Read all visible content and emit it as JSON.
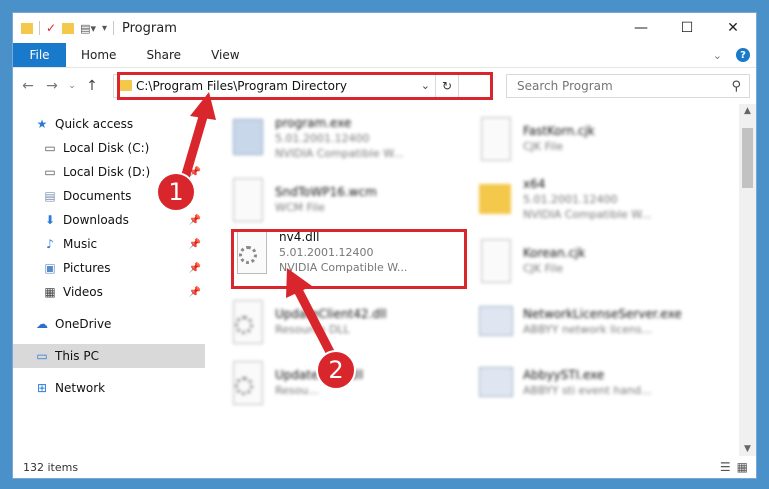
{
  "window": {
    "title": "Program"
  },
  "ribbon": {
    "file": "File",
    "home": "Home",
    "share": "Share",
    "view": "View"
  },
  "nav": {
    "address": "C:\\Program Files\\Program Directory",
    "search_placeholder": "Search Program"
  },
  "sidebar": {
    "items": [
      {
        "label": "Quick access",
        "icon": "star-icon"
      },
      {
        "label": "Local Disk (C:)",
        "icon": "drive-icon"
      },
      {
        "label": "Local Disk (D:)",
        "icon": "drive-icon"
      },
      {
        "label": "Documents",
        "icon": "documents-icon"
      },
      {
        "label": "Downloads",
        "icon": "download-icon"
      },
      {
        "label": "Music",
        "icon": "music-icon"
      },
      {
        "label": "Pictures",
        "icon": "pictures-icon"
      },
      {
        "label": "Videos",
        "icon": "videos-icon"
      },
      {
        "label": "OneDrive",
        "icon": "cloud-icon"
      },
      {
        "label": "This PC",
        "icon": "computer-icon"
      },
      {
        "label": "Network",
        "icon": "network-icon"
      }
    ]
  },
  "files": [
    {
      "name": "program.exe",
      "line2": "5.01.2001.12400",
      "line3": "NVIDIA Compatible W...",
      "icon": "exe"
    },
    {
      "name": "FastKorn.cjk",
      "line2": "CJK File",
      "line3": "",
      "icon": "page"
    },
    {
      "name": "SndToWP16.wcm",
      "line2": "WCM File",
      "line3": "",
      "icon": "page"
    },
    {
      "name": "x64",
      "line2": "5.01.2001.12400",
      "line3": "NVIDIA Compatible W...",
      "icon": "folder"
    },
    {
      "name": "",
      "line2": "",
      "line3": "",
      "icon": "none"
    },
    {
      "name": "Korean.cjk",
      "line2": "CJK File",
      "line3": "",
      "icon": "page"
    },
    {
      "name": "UpdateClient42.dll",
      "line2": "Resource DLL",
      "line3": "",
      "icon": "gear"
    },
    {
      "name": "NetworkLicenseServer.exe",
      "line2": "ABBYY network licens...",
      "line3": "",
      "icon": "server"
    },
    {
      "name": "Update...65.dll",
      "line2": "Resou...",
      "line3": "",
      "icon": "gear"
    },
    {
      "name": "AbbyySTI.exe",
      "line2": "ABBYY sti event hand...",
      "line3": "",
      "icon": "server"
    }
  ],
  "focus_file": {
    "name": "nv4.dll",
    "version": "5.01.2001.12400",
    "description": "NVIDIA Compatible W..."
  },
  "status": {
    "count": "132 items"
  },
  "annotations": {
    "step1": "1",
    "step2": "2",
    "color": "#d9262c"
  }
}
